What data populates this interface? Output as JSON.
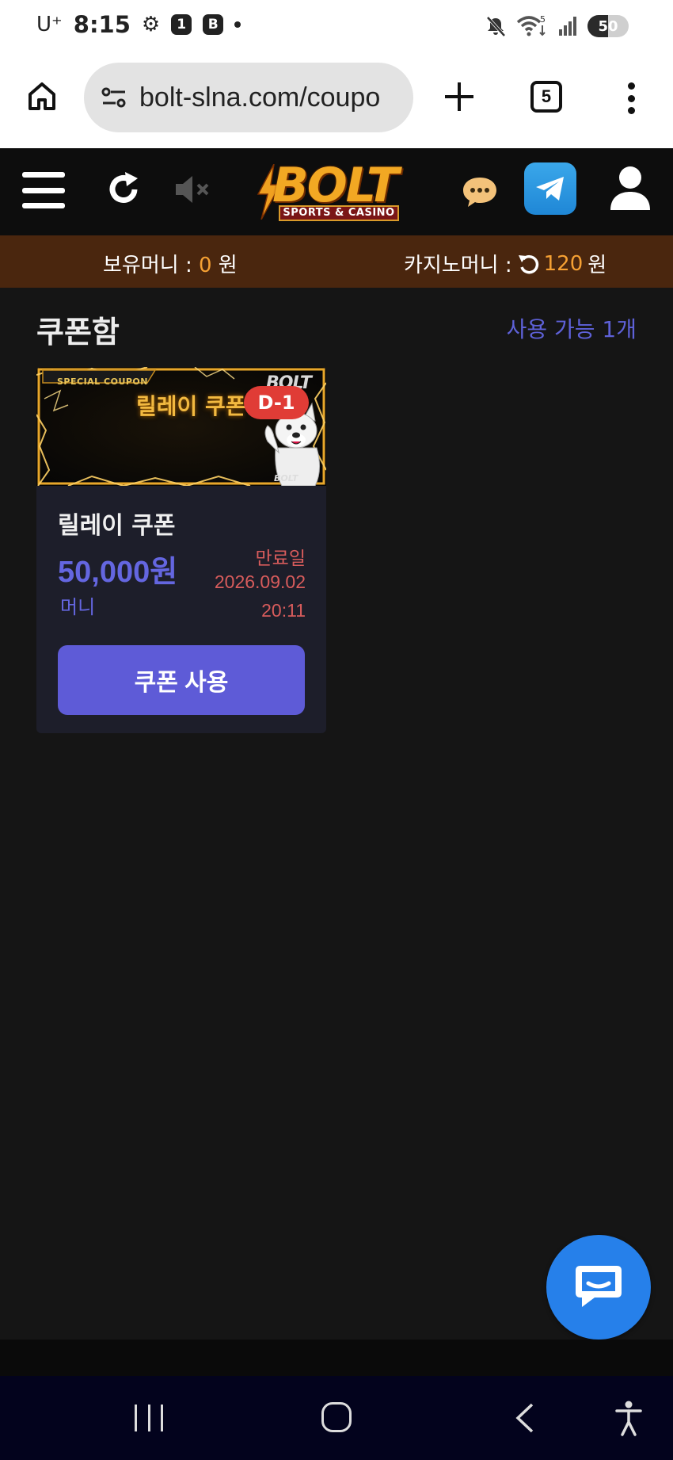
{
  "status_bar": {
    "carrier": "U⁺",
    "time": "8:15",
    "badge_1": "1",
    "badge_2": "B",
    "network_sup": "5",
    "battery": "50",
    "battery_level": 0.5
  },
  "browser": {
    "url": "bolt-slna.com/coupo",
    "tab_count": "5"
  },
  "site": {
    "logo_text": "BOLT",
    "logo_sub": "SPORTS & CASINO"
  },
  "balance": {
    "holding_label": "보유머니 :",
    "holding_value": "0",
    "holding_unit": "원",
    "casino_label": "카지노머니 :",
    "casino_value": "120",
    "casino_unit": "원"
  },
  "coupon_box": {
    "title": "쿠폰함",
    "available": "사용 가능 1개"
  },
  "coupons": [
    {
      "banner_label": "SPECIAL COUPON",
      "banner_title": "릴레이 쿠폰",
      "banner_logo": "BOLT",
      "banner_mini_logo": "BOLT",
      "dday": "D-1",
      "name": "릴레이 쿠폰",
      "amount": "50,000원",
      "type": "머니",
      "expire_label": "만료일",
      "expire_date": "2026.09.02",
      "expire_time": "20:11",
      "button": "쿠폰 사용"
    }
  ],
  "colors": {
    "accent": "#5e5bd7",
    "balance_bar": "#4a260e",
    "orange": "#f5a033",
    "expire_red": "#d85c5c",
    "dday_red": "#e03c36",
    "float_chat": "#2680ea"
  }
}
